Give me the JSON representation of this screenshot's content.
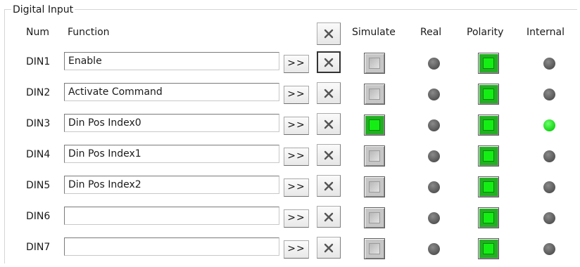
{
  "group": {
    "title": "Digital Input"
  },
  "headers": {
    "num": "Num",
    "function": "Function",
    "simulate": "Simulate",
    "real": "Real",
    "polarity": "Polarity",
    "internal": "Internal"
  },
  "arrow_label": ">>",
  "icons": {
    "clear": "close-x-icon"
  },
  "colors": {
    "led_on": "#15ee15",
    "led_off": "#5a5a5a",
    "square_off": "#c6c6c6"
  },
  "rows": [
    {
      "num": "DIN1",
      "function": "Enable",
      "simulate": false,
      "real": false,
      "polarity": true,
      "internal": false,
      "clear_pressed": true
    },
    {
      "num": "DIN2",
      "function": "Activate Command",
      "simulate": false,
      "real": false,
      "polarity": true,
      "internal": false,
      "clear_pressed": false
    },
    {
      "num": "DIN3",
      "function": "Din Pos Index0",
      "simulate": true,
      "real": false,
      "polarity": true,
      "internal": true,
      "clear_pressed": false
    },
    {
      "num": "DIN4",
      "function": "Din Pos Index1",
      "simulate": false,
      "real": false,
      "polarity": true,
      "internal": false,
      "clear_pressed": false
    },
    {
      "num": "DIN5",
      "function": "Din Pos Index2",
      "simulate": false,
      "real": false,
      "polarity": true,
      "internal": false,
      "clear_pressed": false
    },
    {
      "num": "DIN6",
      "function": "",
      "simulate": false,
      "real": false,
      "polarity": true,
      "internal": false,
      "clear_pressed": false
    },
    {
      "num": "DIN7",
      "function": "",
      "simulate": false,
      "real": false,
      "polarity": true,
      "internal": false,
      "clear_pressed": false
    }
  ]
}
